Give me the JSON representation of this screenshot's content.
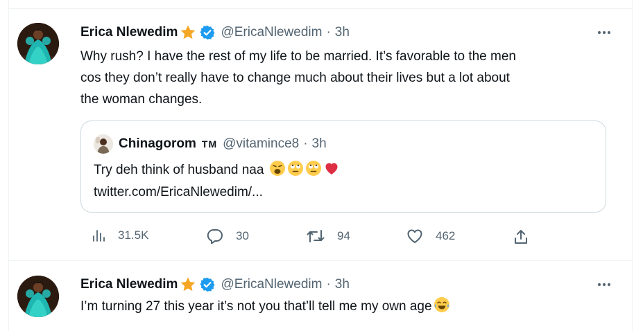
{
  "tweets": [
    {
      "name": "Erica Nlewedim",
      "handle": "@EricaNlewedim",
      "time": "3h",
      "text_lines": [
        "Why rush? I have the rest of my life to be married. It’s favorable to the men",
        "cos they don’t really have to change much about their lives but a lot about",
        "the woman changes."
      ],
      "quote": {
        "name": "Chinagorom",
        "tm": "TM",
        "handle": "@vitamince8",
        "time": "3h",
        "text": "Try deh think of husband naa",
        "link": "twitter.com/EricaNlewedim/..."
      },
      "stats": {
        "views": "31.5K",
        "replies": "30",
        "retweets": "94",
        "likes": "462"
      }
    },
    {
      "name": "Erica Nlewedim",
      "handle": "@EricaNlewedim",
      "time": "3h",
      "text": "I’m turning 27 this year it’s not you that’ll tell me my own age"
    }
  ],
  "separator": "·",
  "icons": {
    "verified": "verified-badge-icon",
    "star": "star-emoji-icon",
    "more": "more-options-icon",
    "views": "views-chart-icon",
    "reply": "reply-icon",
    "retweet": "retweet-icon",
    "like": "like-heart-icon",
    "share": "share-icon"
  },
  "colors": {
    "text": "#0f1419",
    "secondary": "#536471",
    "verified": "#1d9bf0",
    "border": "#cfd9de"
  }
}
